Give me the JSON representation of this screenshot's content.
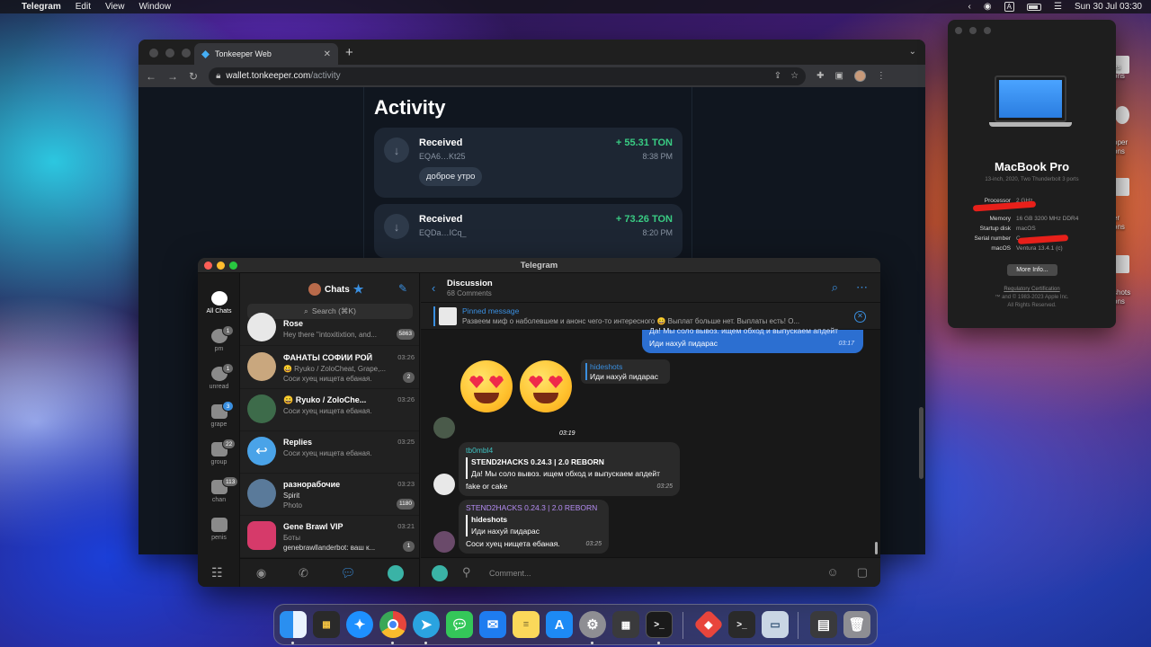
{
  "menubar": {
    "app_name": "Telegram",
    "items": [
      "Edit",
      "View",
      "Window"
    ],
    "clock": "Sun 30 Jul  03:30",
    "input_source": "A"
  },
  "browser": {
    "tab_title": "Tonkeeper Web",
    "url_domain": "wallet.tonkeeper.com",
    "url_path": "/activity",
    "page": {
      "title": "Activity",
      "transactions": [
        {
          "type": "Received",
          "amount": "+ 55.31 TON",
          "address": "EQA6…Kt25",
          "time": "8:38 PM",
          "comment": "доброе утро"
        },
        {
          "type": "Received",
          "amount": "+ 73.26 TON",
          "address": "EQDa…ICq_",
          "time": "8:20 PM"
        }
      ]
    }
  },
  "telegram": {
    "window_title": "Telegram",
    "folders": [
      {
        "label": "All Chats",
        "badge": ""
      },
      {
        "label": "pm",
        "badge": "1"
      },
      {
        "label": "unread",
        "badge": "1"
      },
      {
        "label": "grape",
        "badge": "3"
      },
      {
        "label": "group",
        "badge": "22"
      },
      {
        "label": "chan",
        "badge": "113"
      },
      {
        "label": "penis",
        "badge": ""
      }
    ],
    "chatlist": {
      "title": "Chats",
      "search_placeholder": "Search (⌘K)",
      "chats": [
        {
          "name": "Rose",
          "time": "",
          "preview": "Hey there ''intoxitixtion, and...",
          "preview2": "",
          "badge": "5863"
        },
        {
          "name": "ФАНАТЫ СОФИИ РОЙ",
          "time": "03:26",
          "preview": "😀 Ryuko / ZoloCheat, Grape,...",
          "preview2": "Соси хуец нищета ебаная.",
          "badge": "2"
        },
        {
          "name": "😀 Ryuko / ZoloChe...",
          "time": "03:26",
          "preview": "Соси хуец нищета ебаная.",
          "preview2": "",
          "badge": ""
        },
        {
          "name": "Replies",
          "time": "03:25",
          "preview": "Соси хуец нищета ебаная.",
          "preview2": "",
          "badge": ""
        },
        {
          "name": "разнорабочие",
          "time": "03:23",
          "preview": "Spirit",
          "preview2": "Photo",
          "badge": "1180"
        },
        {
          "name": "Gene Brawl VIP",
          "time": "03:21",
          "preview": "Боты",
          "preview2": "genebrawllanderbot: ваш к...",
          "badge": "1"
        }
      ]
    },
    "conversation": {
      "title": "Discussion",
      "subtitle": "68 Comments",
      "pinned": {
        "label": "Pinned message",
        "text": "Развеем миф о наболевшем и анонс чего-то интересного 😀  Выплат больше нет. Выплаты есть! О..."
      },
      "messages": {
        "outgoing": {
          "line1": "Да! Мы соло вывоз. ищем обход и выпускаем апдейт",
          "line2": "Иди нахуй пидарас",
          "time": "03:17"
        },
        "reply_preview": {
          "name": "hideshots",
          "text": "Иди нахуй пидарас"
        },
        "sticker_time": "03:19",
        "msg1": {
          "sender": "tb0mbl4",
          "quote_title": "STEND2HACKS 0.24.3 | 2.0 REBORN",
          "quote_text": "Да! Мы соло вывоз. ищем обход и выпускаем апдейт",
          "body": "fake or cake",
          "time": "03:25"
        },
        "msg2": {
          "sender": "STEND2HACKS 0.24.3 | 2.0 REBORN",
          "quote_title": "hideshots",
          "quote_text": "Иди нахуй пидарас",
          "body": "Соси хуец нищета ебаная.",
          "time": "03:25"
        }
      },
      "composer_placeholder": "Comment..."
    }
  },
  "about_mac": {
    "model": "MacBook Pro",
    "subtitle": "13-inch, 2020, Two Thunderbolt 3 ports",
    "specs": [
      {
        "key": "Processor",
        "value": "2 GHz"
      },
      {
        "key": "Memory",
        "value": "16 GB 3200 MHz DDR4"
      },
      {
        "key": "Startup disk",
        "value": "macOS"
      },
      {
        "key": "Serial number",
        "value": "C"
      },
      {
        "key": "macOS",
        "value": "Ventura 13.4.1 (c)"
      }
    ],
    "more_info": "More Info...",
    "regulatory": "Regulatory Certification",
    "copyright": "™ and © 1983-2023 Apple Inc.",
    "rights": "All Rights Reserved."
  },
  "desktop_labels": [
    "es",
    "ons",
    "oper",
    "ons",
    "er",
    "ons",
    "shots",
    "ons"
  ],
  "colors": {
    "telegram_accent": "#3a8fe0",
    "tonkeeper_green": "#39cc83",
    "outgoing_bubble": "#2c6fd1",
    "sender_teal": "#3fc0c0",
    "sender_purple": "#b48cf2"
  }
}
